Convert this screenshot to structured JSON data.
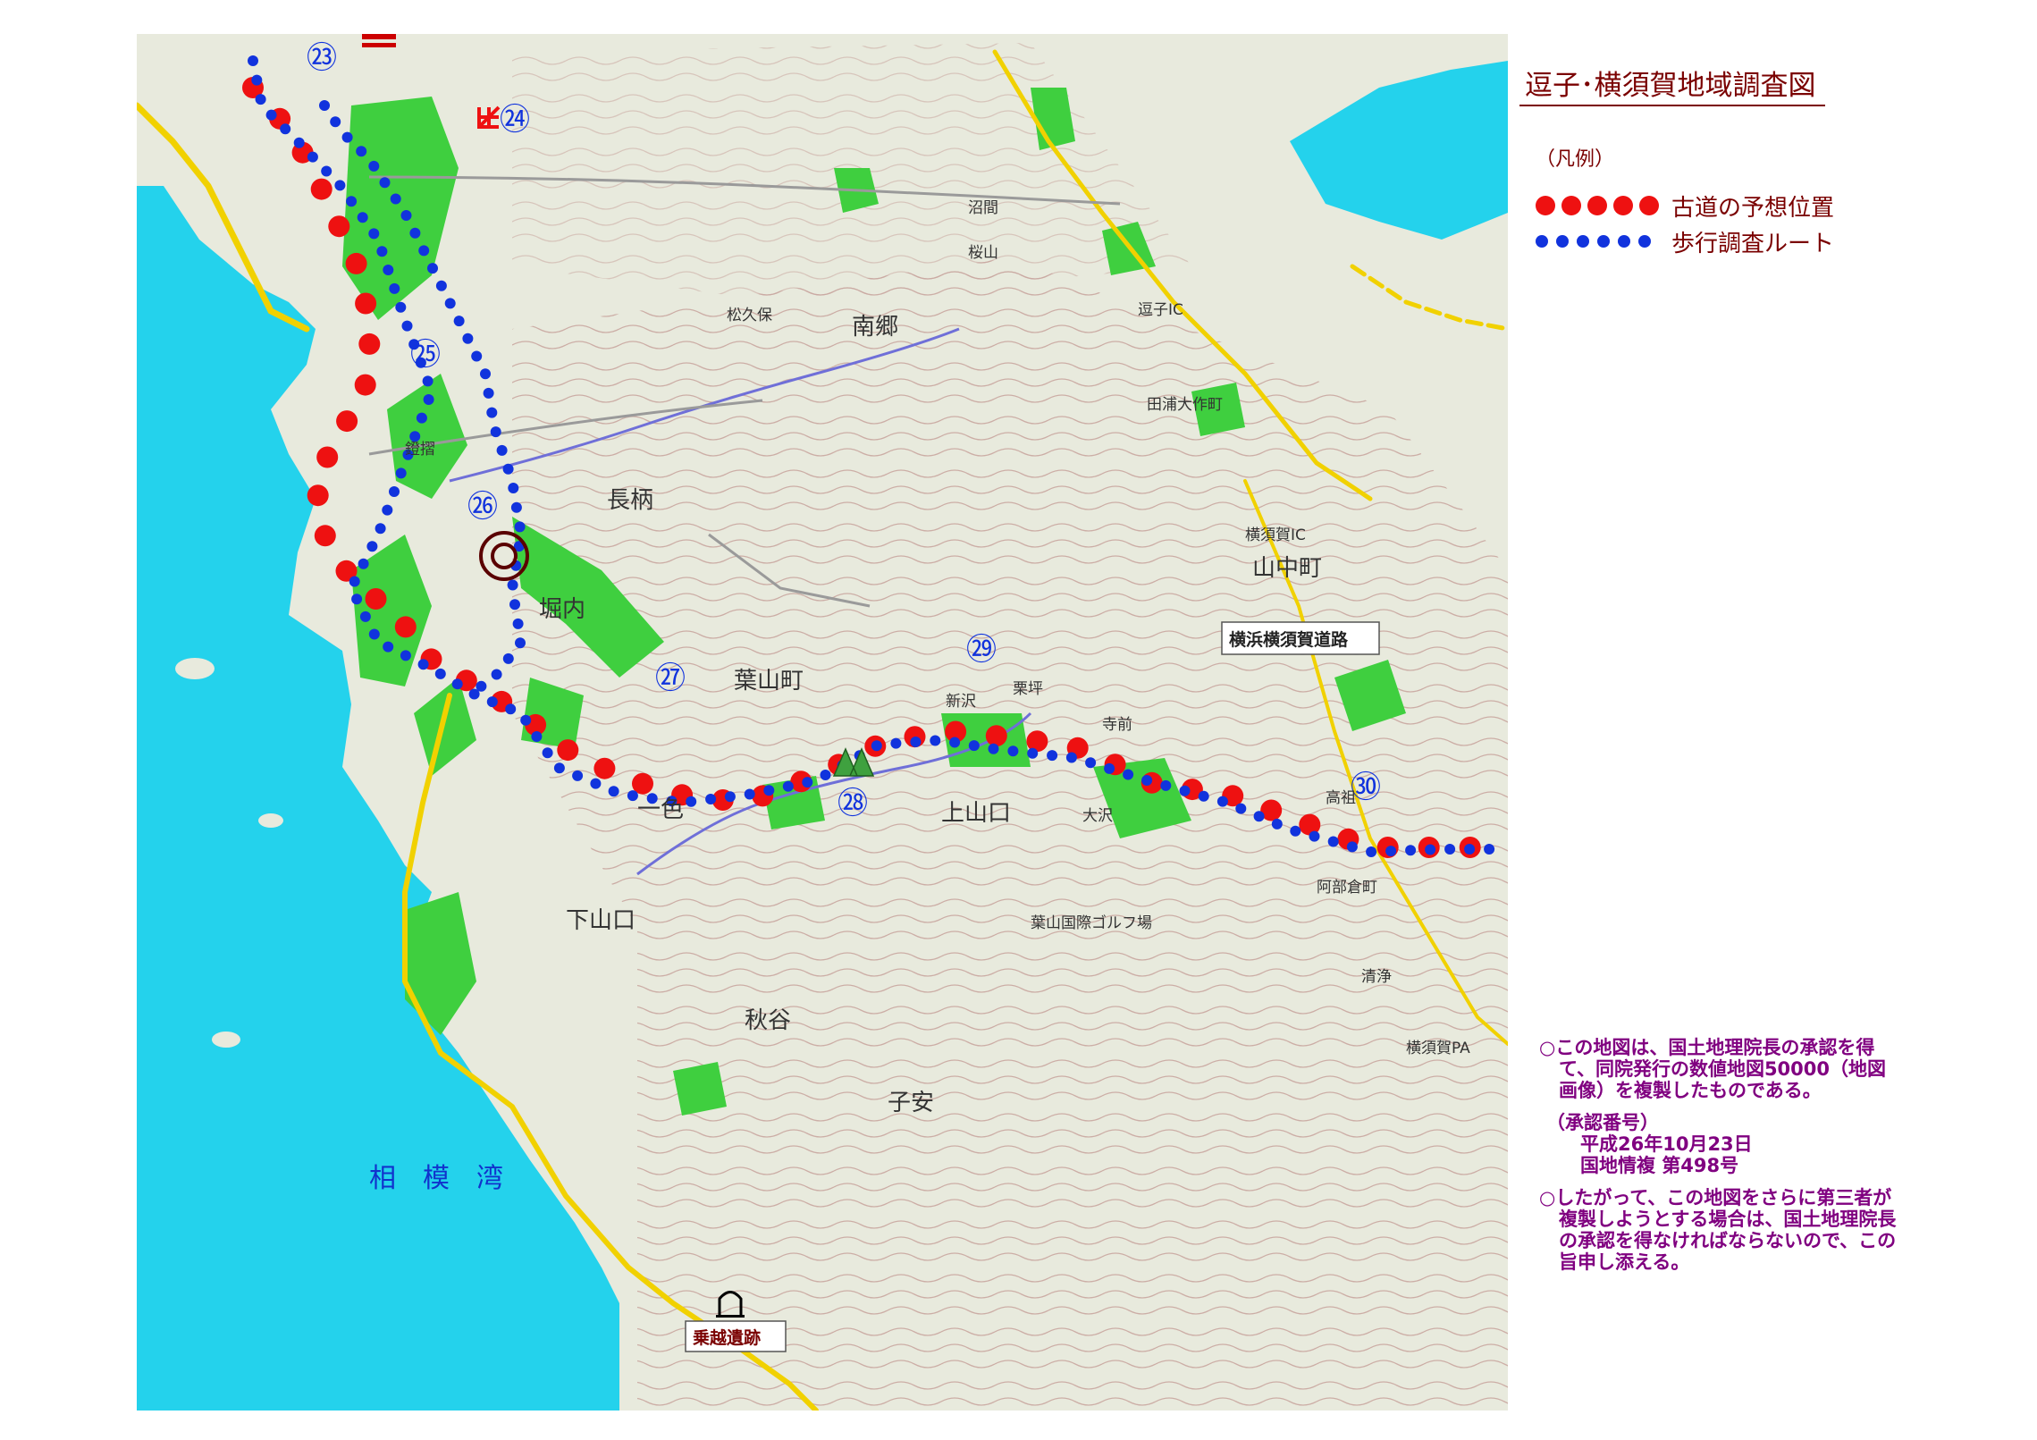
{
  "title": "逗子･横須賀地域調査図",
  "legend": {
    "heading": "（凡例）",
    "items": [
      {
        "label": "古道の予想位置",
        "color": "#ee1111",
        "dot_count": 5
      },
      {
        "label": "歩行調査ルート",
        "color": "#1133dd",
        "dot_count": 6
      }
    ]
  },
  "stations": {
    "s23": "㉓",
    "s24": "㉔",
    "s25": "㉕",
    "s26": "㉖",
    "s27": "㉗",
    "s28": "㉘",
    "s29": "㉙",
    "s30": "㉚"
  },
  "map_labels": {
    "sea": "相模湾",
    "road": "横浜横須賀道路",
    "site": "乗越遺跡",
    "places": {
      "nagae": "長柄",
      "horiuchi": "堀内",
      "hayama": "葉山町",
      "kamiyamaguchi": "上山口",
      "shimoyamaguchi": "下山口",
      "yamanaka": "山中町",
      "koyasu": "子安",
      "shinzawa": "新沢",
      "kurihira": "栗坪",
      "isshiki": "一色",
      "shiki": "秋谷",
      "nango": "南郷",
      "matsukubo": "松久保",
      "tauracho": "田浦大作町",
      "ofuna": "大沢",
      "abekura": "阿部倉町",
      "takazo": "高祖",
      "jimon": "寺前",
      "numama": "沼間",
      "sakurayama": "桜山",
      "kusaka": "鐙摺",
      "kiyokawa": "清浄",
      "zushiic": "逗子IC",
      "yokosukaic": "横須賀IC",
      "yokosukapa": "横須賀PA",
      "hayamagolf": "葉山国際ゴルフ場"
    }
  },
  "notes": {
    "p1": "○この地図は、国土地理院長の承認を得て、同院発行の数値地図50000（地図画像）を複製したものである。",
    "approval_head": "（承認番号）",
    "approval_l1": "平成26年10月23日",
    "approval_l2": "国地情複 第498号",
    "p2": "○したがって、この地図をさらに第三者が複製しようとする場合は、国土地理院長の承認を得なければならないので、この旨申し添える。"
  },
  "colors": {
    "sea": "#24d2ec",
    "forest": "#3fcf3f",
    "road": "#f1d100",
    "ancient_route": "#ee1111",
    "survey_route": "#1133dd",
    "title": "#7a0000",
    "notes": "#800080"
  }
}
